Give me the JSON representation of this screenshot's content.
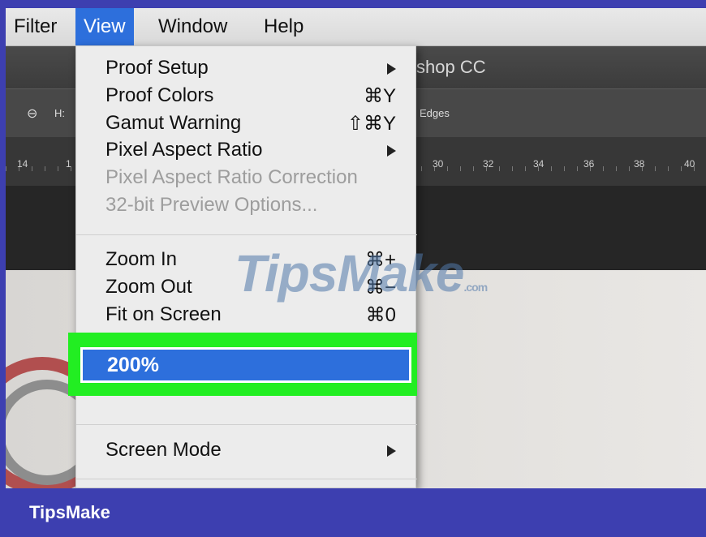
{
  "menubar": {
    "items": [
      "Filter",
      "View",
      "Window",
      "Help"
    ],
    "active": "View"
  },
  "titlebar": {
    "title": "shop CC"
  },
  "optionsbar": {
    "link_icon": "⊖",
    "h_label": "H:",
    "edges_label": "Edges"
  },
  "ruler": {
    "ticks": [
      "14",
      "1",
      "30",
      "32",
      "34",
      "36",
      "38",
      "40"
    ]
  },
  "menu": {
    "items": [
      {
        "label": "Proof Setup",
        "shortcut": "",
        "submenu": true,
        "enabled": true
      },
      {
        "label": "Proof Colors",
        "shortcut": "⌘Y",
        "submenu": false,
        "enabled": true
      },
      {
        "label": "Gamut Warning",
        "shortcut": "⇧⌘Y",
        "submenu": false,
        "enabled": true
      },
      {
        "label": "Pixel Aspect Ratio",
        "shortcut": "",
        "submenu": true,
        "enabled": true
      },
      {
        "label": "Pixel Aspect Ratio Correction",
        "shortcut": "",
        "submenu": false,
        "enabled": false
      },
      {
        "label": "32-bit Preview Options...",
        "shortcut": "",
        "submenu": false,
        "enabled": false
      },
      {
        "label": "Zoom In",
        "shortcut": "⌘+",
        "submenu": false,
        "enabled": true
      },
      {
        "label": "Zoom Out",
        "shortcut": "⌘−",
        "submenu": false,
        "enabled": true
      },
      {
        "label": "Fit on Screen",
        "shortcut": "⌘0",
        "submenu": false,
        "enabled": true
      },
      {
        "label": "200%",
        "shortcut": "",
        "submenu": false,
        "enabled": true,
        "highlighted": true
      },
      {
        "label": "Screen Mode",
        "shortcut": "",
        "submenu": true,
        "enabled": true
      }
    ]
  },
  "watermark": {
    "text": "TipsMake",
    "suffix": ".com"
  },
  "footer": {
    "brand": "TipsMake"
  },
  "colors": {
    "highlight": "#2d6fdc",
    "callout": "#22ee22",
    "frame": "#3d3fb0"
  }
}
